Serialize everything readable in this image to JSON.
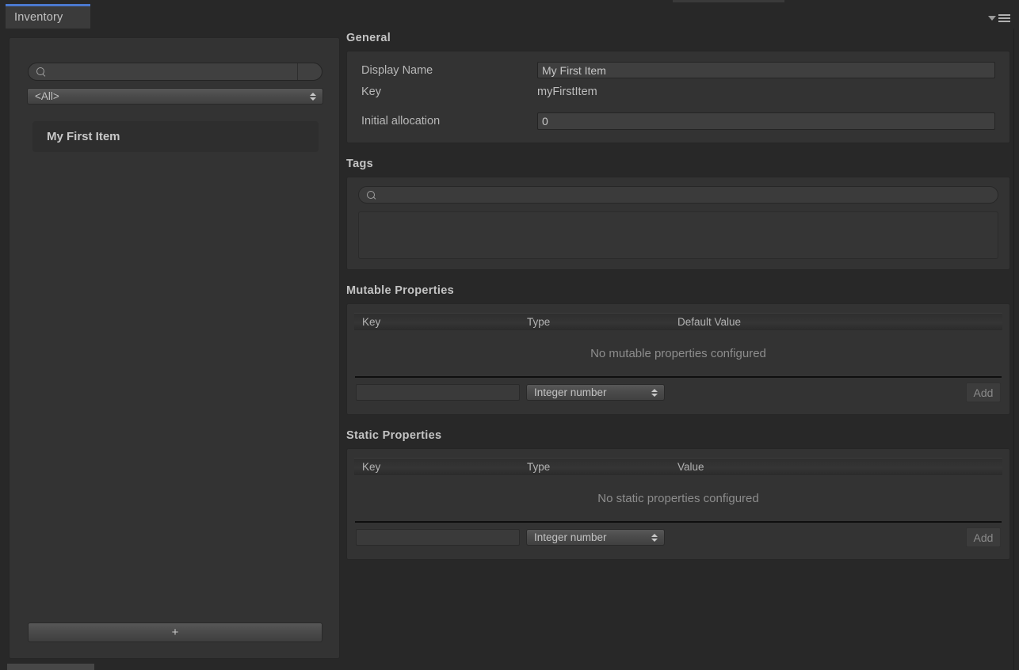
{
  "window": {
    "tab_label": "Inventory",
    "menu_icon": "hamburger-menu-icon",
    "menu_chevron_icon": "chevron-down-icon",
    "accent_color": "#4b79cf",
    "panel_bg": "#333333",
    "window_bg": "#282828"
  },
  "sidebar": {
    "search": {
      "icon": "search-icon",
      "value": "",
      "placeholder": ""
    },
    "filter_dropdown": {
      "selected": "<All>",
      "arrows_icon": "updown-arrows-icon"
    },
    "items": [
      {
        "label": "My First Item",
        "selected": true
      }
    ],
    "add_button_label": "+"
  },
  "general": {
    "title": "General",
    "display_name": {
      "label": "Display Name",
      "value": "My First Item"
    },
    "key": {
      "label": "Key",
      "value": "myFirstItem"
    },
    "initial_allocation": {
      "label": "Initial allocation",
      "value": "0"
    }
  },
  "tags": {
    "title": "Tags",
    "search": {
      "icon": "search-icon",
      "value": "",
      "placeholder": ""
    },
    "list_items": []
  },
  "mutable_properties": {
    "title": "Mutable Properties",
    "columns": [
      "Key",
      "Type",
      "Default Value"
    ],
    "rows": [],
    "empty_message": "No mutable properties configured",
    "new_key": {
      "value": "",
      "placeholder": ""
    },
    "new_type": {
      "selected": "Integer number",
      "arrows_icon": "updown-arrows-icon"
    },
    "add_button_label": "Add",
    "add_button_enabled": false
  },
  "static_properties": {
    "title": "Static Properties",
    "columns": [
      "Key",
      "Type",
      "Value"
    ],
    "rows": [],
    "empty_message": "No static properties configured",
    "new_key": {
      "value": "",
      "placeholder": ""
    },
    "new_type": {
      "selected": "Integer number",
      "arrows_icon": "updown-arrows-icon"
    },
    "add_button_label": "Add",
    "add_button_enabled": false
  }
}
